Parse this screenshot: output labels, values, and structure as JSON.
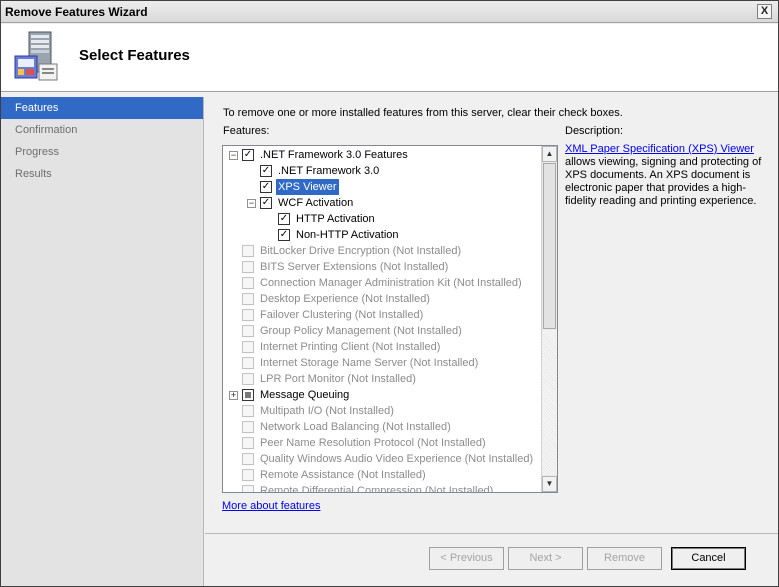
{
  "window": {
    "title": "Remove Features Wizard",
    "close_label": "X"
  },
  "header": {
    "heading": "Select Features",
    "logo_icon": "server-features-icon"
  },
  "sidebar": {
    "steps": [
      {
        "label": "Features",
        "active": true
      },
      {
        "label": "Confirmation",
        "active": false
      },
      {
        "label": "Progress",
        "active": false
      },
      {
        "label": "Results",
        "active": false
      }
    ]
  },
  "main": {
    "instruction": "To remove one or more installed features from this server, clear their check boxes.",
    "features_label": "Features:",
    "description_label": "Description:",
    "more_link": "More about features"
  },
  "tree": {
    "items": [
      {
        "label": ".NET Framework 3.0 Features",
        "level": 0,
        "expander": "⊟",
        "state": "checked",
        "enabled": true
      },
      {
        "label": ".NET Framework 3.0",
        "level": 1,
        "expander": "",
        "state": "checked",
        "enabled": true
      },
      {
        "label": "XPS Viewer",
        "level": 1,
        "expander": "",
        "state": "checked",
        "enabled": true,
        "selected": true
      },
      {
        "label": "WCF Activation",
        "level": 1,
        "expander": "⊟",
        "state": "checked",
        "enabled": true
      },
      {
        "label": "HTTP Activation",
        "level": 2,
        "expander": "",
        "state": "checked",
        "enabled": true
      },
      {
        "label": "Non-HTTP Activation",
        "level": 2,
        "expander": "",
        "state": "checked",
        "enabled": true
      },
      {
        "label": "BitLocker Drive Encryption  (Not Installed)",
        "level": 0,
        "expander": "",
        "state": "unchecked",
        "enabled": false
      },
      {
        "label": "BITS Server Extensions  (Not Installed)",
        "level": 0,
        "expander": "",
        "state": "unchecked",
        "enabled": false
      },
      {
        "label": "Connection Manager Administration Kit  (Not Installed)",
        "level": 0,
        "expander": "",
        "state": "unchecked",
        "enabled": false
      },
      {
        "label": "Desktop Experience  (Not Installed)",
        "level": 0,
        "expander": "",
        "state": "unchecked",
        "enabled": false
      },
      {
        "label": "Failover Clustering  (Not Installed)",
        "level": 0,
        "expander": "",
        "state": "unchecked",
        "enabled": false
      },
      {
        "label": "Group Policy Management  (Not Installed)",
        "level": 0,
        "expander": "",
        "state": "unchecked",
        "enabled": false
      },
      {
        "label": "Internet Printing Client  (Not Installed)",
        "level": 0,
        "expander": "",
        "state": "unchecked",
        "enabled": false
      },
      {
        "label": "Internet Storage Name Server  (Not Installed)",
        "level": 0,
        "expander": "",
        "state": "unchecked",
        "enabled": false
      },
      {
        "label": "LPR Port Monitor  (Not Installed)",
        "level": 0,
        "expander": "",
        "state": "unchecked",
        "enabled": false
      },
      {
        "label": "Message Queuing",
        "level": 0,
        "expander": "⊞",
        "state": "partial",
        "enabled": true
      },
      {
        "label": "Multipath I/O  (Not Installed)",
        "level": 0,
        "expander": "",
        "state": "unchecked",
        "enabled": false
      },
      {
        "label": "Network Load Balancing  (Not Installed)",
        "level": 0,
        "expander": "",
        "state": "unchecked",
        "enabled": false
      },
      {
        "label": "Peer Name Resolution Protocol  (Not Installed)",
        "level": 0,
        "expander": "",
        "state": "unchecked",
        "enabled": false
      },
      {
        "label": "Quality Windows Audio Video Experience  (Not Installed)",
        "level": 0,
        "expander": "",
        "state": "unchecked",
        "enabled": false
      },
      {
        "label": "Remote Assistance  (Not Installed)",
        "level": 0,
        "expander": "",
        "state": "unchecked",
        "enabled": false
      },
      {
        "label": "Remote Differential Compression  (Not Installed)",
        "level": 0,
        "expander": "",
        "state": "unchecked",
        "enabled": false
      }
    ],
    "scroll_up_glyph": "▲",
    "scroll_down_glyph": "▼"
  },
  "description": {
    "link_text": "XML Paper Specification (XPS) Viewer",
    "body": " allows viewing, signing and protecting of XPS documents. An XPS document is electronic paper that provides a high-fidelity reading and printing experience."
  },
  "buttons": {
    "previous": {
      "label": "< Previous",
      "enabled": false
    },
    "next": {
      "label": "Next >",
      "enabled": false
    },
    "remove": {
      "label": "Remove",
      "enabled": false
    },
    "cancel": {
      "label": "Cancel",
      "enabled": true
    }
  },
  "colors": {
    "selection": "#3169c6",
    "link": "#0000ee",
    "disabled_text": "#8c8c8c"
  }
}
